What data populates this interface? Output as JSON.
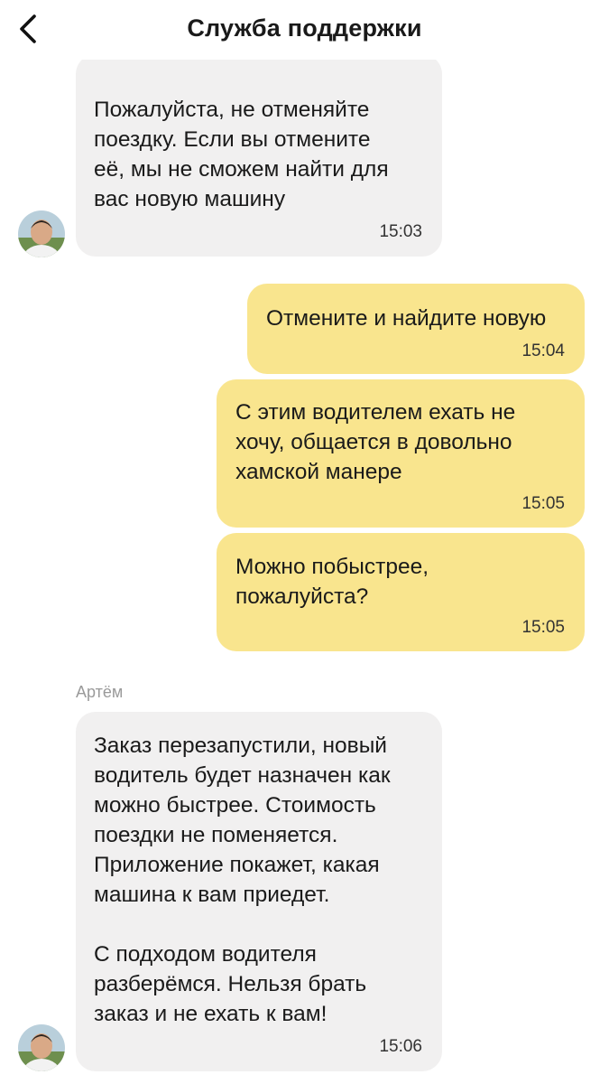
{
  "header": {
    "title": "Служба поддержки",
    "back_icon": "chevron-left-icon"
  },
  "messages": [
    {
      "side": "incoming",
      "text": "Пожалуйста, не отменяйте\nпоездку. Если вы отмените\nеё, мы не сможем найти для\nвас новую машину",
      "time": "15:03"
    },
    {
      "side": "outgoing",
      "text": "Отмените и найдите новую",
      "time": "15:04"
    },
    {
      "side": "outgoing",
      "text": "С этим водителем ехать не\nхочу, общается в довольно\nхамской манере",
      "time": "15:05"
    },
    {
      "side": "outgoing",
      "text": "Можно побыстрее,\nпожалуйста?",
      "time": "15:05"
    },
    {
      "side": "incoming",
      "sender": "Артём",
      "text": "Заказ перезапустили, новый\nводитель будет назначен как\nможно быстрее. Стоимость\nпоездки не поменяется.\nПриложение покажет, какая\nмашина к вам приедет.\n\nС подходом водителя\nразберёмся. Нельзя брать\nзаказ и не ехать к вам!",
      "time": "15:06"
    }
  ],
  "colors": {
    "incoming_bubble": "#f1f0f0",
    "outgoing_bubble": "#f9e58e",
    "background": "#ffffff"
  }
}
